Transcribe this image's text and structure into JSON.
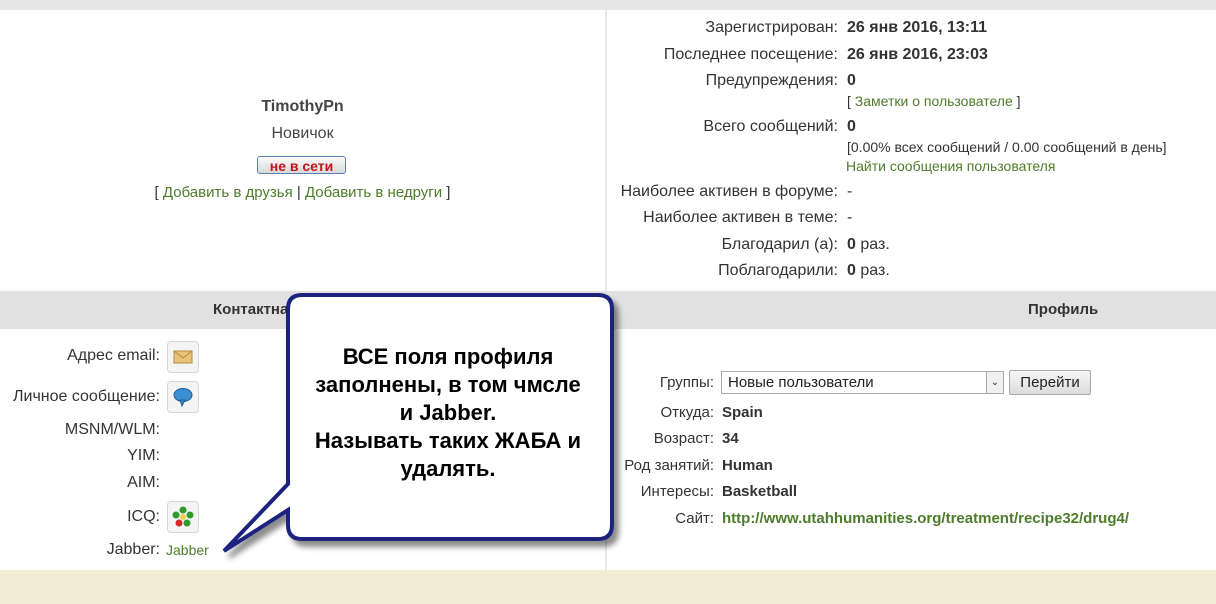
{
  "user": {
    "name": "TimothyPn",
    "rank": "Новичок",
    "status": "не в сети",
    "links_open": "[ ",
    "add_friend": "Добавить в друзья",
    "links_sep": " | ",
    "add_foe": "Добавить в недруги",
    "links_close": " ]"
  },
  "stats": {
    "registered_label": "Зарегистрирован:",
    "registered_value": "26 янв 2016, 13:11",
    "last_visit_label": "Последнее посещение:",
    "last_visit_value": "26 янв 2016, 23:03",
    "warnings_label": "Предупреждения:",
    "warnings_value": "0",
    "notes_open": "[ ",
    "notes_link": "Заметки о пользователе",
    "notes_close": " ]",
    "posts_label": "Всего сообщений:",
    "posts_value": "0",
    "posts_detail": "[0.00% всех сообщений / 0.00 сообщений в день]",
    "find_posts_link": "Найти сообщения пользователя",
    "active_forum_label": "Наиболее активен в форуме:",
    "active_forum_value": "-",
    "active_topic_label": "Наиболее активен в теме:",
    "active_topic_value": "-",
    "thanked_label": "Благодарил (а):",
    "thanked_value": "0",
    "thanked_unit": "раз.",
    "was_thanked_label": "Поблагодарили:",
    "was_thanked_value": "0",
    "was_thanked_unit": "раз."
  },
  "sections": {
    "contacts": "Контактна",
    "profile": "Профиль"
  },
  "contacts": {
    "email_label": "Адрес email:",
    "pm_label": "Личное сообщение:",
    "msnm_label": "MSNM/WLM:",
    "yim_label": "YIM:",
    "aim_label": "AIM:",
    "icq_label": "ICQ:",
    "jabber_label": "Jabber:",
    "jabber_value": "Jabber",
    "icons": {
      "email": "envelope-icon",
      "pm": "speech-bubble-icon",
      "icq": "icq-flower-icon"
    }
  },
  "profile": {
    "groups_label": "Группы:",
    "groups_selected": "Новые пользователи",
    "go_button": "Перейти",
    "from_label": "Откуда:",
    "from_value": "Spain",
    "age_label": "Возраст:",
    "age_value": "34",
    "occupation_label": "Род занятий:",
    "occupation_value": "Human",
    "interests_label": "Интересы:",
    "interests_value": "Basketball",
    "site_label": "Сайт:",
    "site_value": "http://www.utahhumanities.org/treatment/recipe32/drug4/"
  },
  "callout": {
    "line1": "ВСЕ поля профиля",
    "line2": "заполнены, в том чмсле",
    "line3": "и Jabber.",
    "line4": "Называть таких ЖАБА и",
    "line5": "удалять."
  },
  "colors": {
    "link": "#4e7c2a",
    "section_bar": "#e1e1e1",
    "footer": "#f2ecd5",
    "status_text": "#c0141b",
    "callout_border": "#1a237e"
  }
}
